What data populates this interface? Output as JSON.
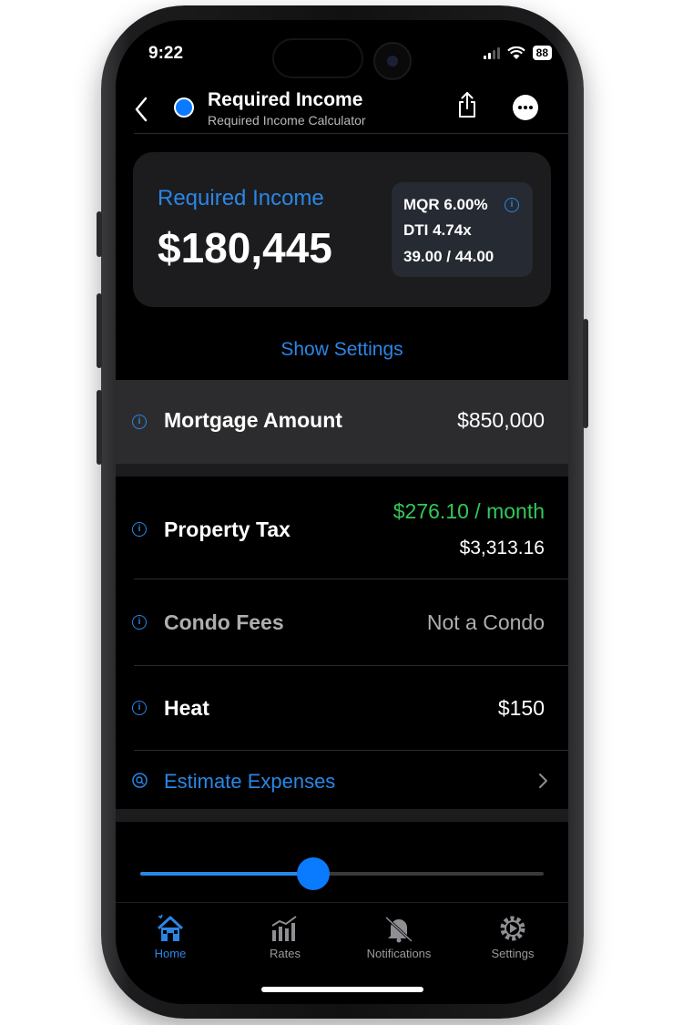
{
  "status_bar": {
    "time": "9:22",
    "battery": "88"
  },
  "header": {
    "title": "Required Income",
    "subtitle": "Required Income Calculator",
    "accent": "#0a7aff"
  },
  "summary": {
    "label": "Required Income",
    "value": "$180,445",
    "mqr": "MQR 6.00%",
    "dti": "DTI 4.74x",
    "ratio": "39.00 / 44.00"
  },
  "show_settings": "Show Settings",
  "rows": {
    "mortgage": {
      "label": "Mortgage Amount",
      "value": "$850,000"
    },
    "property_tax": {
      "label": "Property Tax",
      "monthly": "$276.10 / month",
      "value": "$3,313.16"
    },
    "condo": {
      "label": "Condo Fees",
      "value": "Not a Condo"
    },
    "heat": {
      "label": "Heat",
      "value": "$150"
    },
    "estimate": {
      "label": "Estimate Expenses"
    }
  },
  "slider": {
    "fraction": 0.43
  },
  "tabs": [
    {
      "label": "Home",
      "icon": "house-icon",
      "active": true
    },
    {
      "label": "Rates",
      "icon": "chart-icon",
      "active": false
    },
    {
      "label": "Notifications",
      "icon": "bell-icon",
      "active": false
    },
    {
      "label": "Settings",
      "icon": "gear-icon",
      "active": false
    }
  ],
  "colors": {
    "accent_blue": "#2a86e6",
    "positive_green": "#34c759",
    "card_bg": "#1c1c1e",
    "highlight_bg": "#2c2c2e"
  }
}
